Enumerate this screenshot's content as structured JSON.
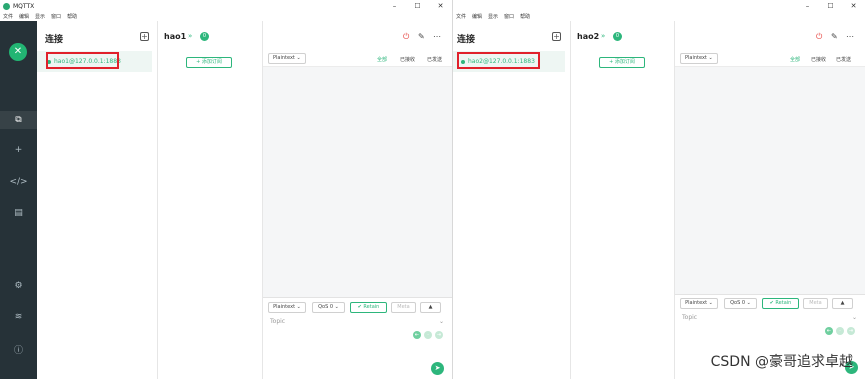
{
  "window1": {
    "title": "MQTTX",
    "menu": [
      "文件",
      "编辑",
      "显示",
      "窗口",
      "帮助"
    ],
    "controls": [
      "–",
      "☐",
      "✕"
    ],
    "panel_title": "连接",
    "connection": "hao1@127.0.0.1:1883",
    "tab_title": "hao1",
    "subscriptions_badge": "0",
    "add_sub_label": "+ 添加订阅",
    "payload_type": "Plaintext",
    "filters": [
      "全部",
      "已接收",
      "已发送"
    ],
    "compose": {
      "payload": "Plaintext",
      "qos": "QoS 0",
      "retain": "Retain",
      "meta": "Meta",
      "topic": "Topic"
    }
  },
  "window2": {
    "menu": [
      "文件",
      "编辑",
      "显示",
      "窗口",
      "帮助"
    ],
    "controls": [
      "–",
      "☐",
      "✕"
    ],
    "panel_title": "连接",
    "connection": "hao2@127.0.0.1:1883",
    "tab_title": "hao2",
    "subscriptions_badge": "0",
    "add_sub_label": "+ 添加订阅",
    "payload_type": "Plaintext",
    "filters": [
      "全部",
      "已接收",
      "已发送"
    ],
    "compose": {
      "payload": "Plaintext",
      "qos": "QoS 0",
      "retain": "Retain",
      "meta": "Meta",
      "topic": "Topic"
    }
  },
  "watermark": "CSDN @豪哥追求卓越",
  "colors": {
    "accent": "#2db67c",
    "sidebar": "#263238",
    "highlight_box": "#e0212b"
  }
}
